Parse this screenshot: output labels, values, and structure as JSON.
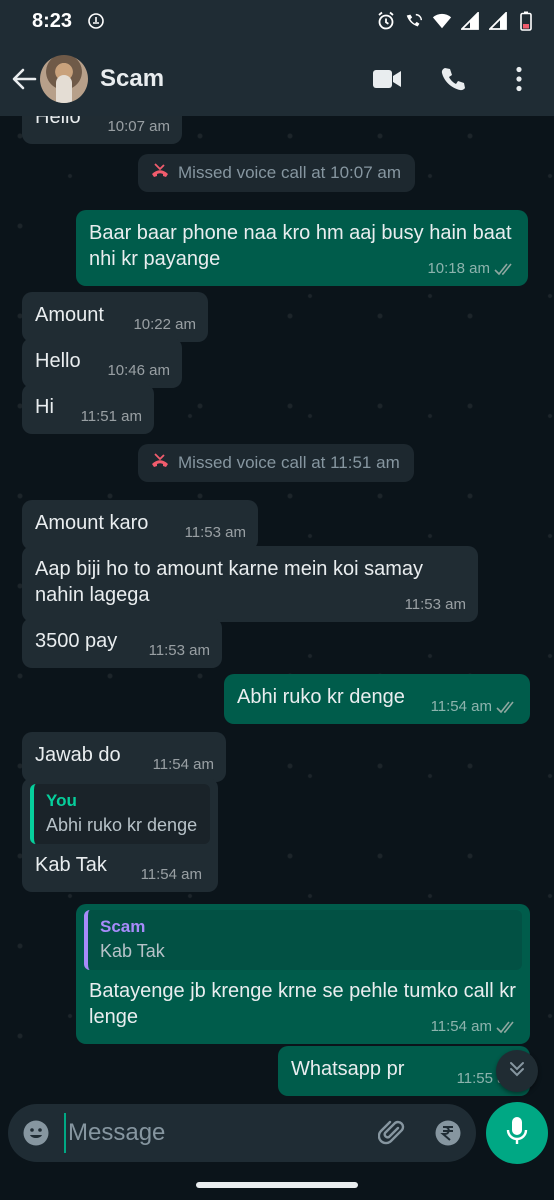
{
  "status_bar": {
    "time": "8:23"
  },
  "header": {
    "contact_name": "Scam"
  },
  "messages": [
    {
      "text": "Hello",
      "time": "10:07 am"
    },
    {
      "text": "Missed voice call at 10:07 am"
    },
    {
      "text": "Baar baar phone naa kro hm aaj busy hain baat nhi kr payange",
      "time": "10:18 am"
    },
    {
      "text": "Amount",
      "time": "10:22 am"
    },
    {
      "text": "Hello",
      "time": "10:46 am"
    },
    {
      "text": "Hi",
      "time": "11:51 am"
    },
    {
      "text": "Missed voice call at 11:51 am"
    },
    {
      "text": "Amount karo",
      "time": "11:53 am"
    },
    {
      "text": "Aap biji ho to amount karne mein koi samay nahin lagega",
      "time": "11:53 am"
    },
    {
      "text": "3500 pay",
      "time": "11:53 am"
    },
    {
      "text": "Abhi ruko kr denge",
      "time": "11:54 am"
    },
    {
      "text": "Jawab do",
      "time": "11:54 am"
    },
    {
      "quote_author": "You",
      "quote_text": "Abhi ruko kr denge",
      "text": "Kab Tak",
      "time": "11:54 am"
    },
    {
      "quote_author": "Scam",
      "quote_text": "Kab Tak",
      "text": "Batayenge jb krenge krne se pehle tumko call kr lenge",
      "time": "11:54 am"
    },
    {
      "text": "Whatsapp pr",
      "time": "11:55 am"
    }
  ],
  "input": {
    "placeholder": "Message"
  },
  "colors": {
    "accent": "#00a884",
    "outgoing": "#005c4b",
    "incoming": "#202c33",
    "missed_call": "#f15c6d"
  },
  "icons": [
    "back-arrow-icon",
    "video-call-icon",
    "voice-call-icon",
    "more-options-icon",
    "missed-call-icon",
    "double-tick-icon",
    "emoji-icon",
    "attach-icon",
    "rupee-icon",
    "camera-icon",
    "mic-icon",
    "scroll-down-icon"
  ]
}
